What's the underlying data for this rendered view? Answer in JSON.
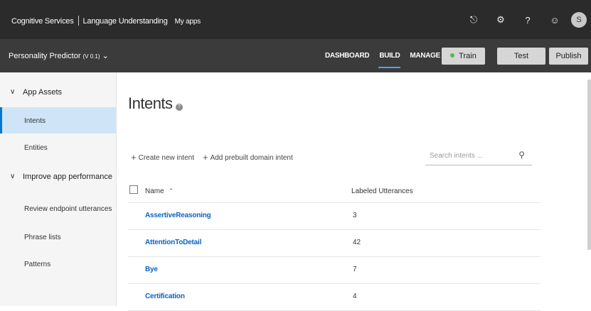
{
  "topbar": {
    "brand": "Cognitive Services",
    "product": "Language Understanding",
    "my_apps": "My apps",
    "icons": [
      "bell-icon",
      "gear-icon",
      "help-icon",
      "smiley-icon"
    ],
    "avatar_initial": "S"
  },
  "app": {
    "name": "Personality Predictor",
    "version": "(V 0.1)"
  },
  "nav_tabs": [
    "DASHBOARD",
    "BUILD",
    "MANAGE"
  ],
  "active_tab": "BUILD",
  "buttons": {
    "train": "Train",
    "test": "Test",
    "publish": "Publish"
  },
  "sidebar": {
    "app_assets": "App Assets",
    "intents": "Intents",
    "entities": "Entities",
    "improve": "Improve app performance",
    "review": "Review endpoint utterances",
    "phrase_lists": "Phrase lists",
    "patterns": "Patterns"
  },
  "main": {
    "title": "Intents",
    "create_intent": "Create new intent",
    "add_prebuilt": "Add prebuilt domain intent",
    "search_placeholder": "Search intents ...",
    "col_name": "Name",
    "col_labeled": "Labeled Utterances",
    "rows": [
      {
        "name": "AssertiveReasoning",
        "count": "3"
      },
      {
        "name": "AttentionToDetail",
        "count": "42"
      },
      {
        "name": "Bye",
        "count": "7"
      },
      {
        "name": "Certification",
        "count": "4"
      }
    ]
  },
  "colors": {
    "topbar_bg": "#2b2b2b",
    "subbar_bg": "#3b3b3b",
    "active_tab_underline": "#4aa3ff",
    "link_blue": "#0b63c4",
    "sidebar_active_bg": "#cfe5f7",
    "train_dot": "#4cbf4c"
  }
}
